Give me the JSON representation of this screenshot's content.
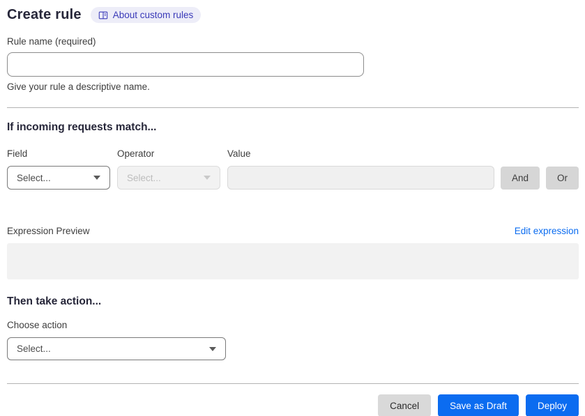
{
  "page": {
    "title": "Create rule",
    "about_link_label": "About custom rules"
  },
  "rule_name": {
    "label": "Rule name (required)",
    "value": "",
    "helper": "Give your rule a descriptive name."
  },
  "match_section": {
    "heading": "If incoming requests match...",
    "field": {
      "label": "Field",
      "selected": "Select..."
    },
    "operator": {
      "label": "Operator",
      "selected": "Select..."
    },
    "value": {
      "label": "Value",
      "value": ""
    },
    "and_button_label": "And",
    "or_button_label": "Or",
    "expression_preview_label": "Expression Preview",
    "edit_expression_link": "Edit expression",
    "expression_value": ""
  },
  "action_section": {
    "heading": "Then take action...",
    "choose_action_label": "Choose action",
    "action_selected": "Select..."
  },
  "footer": {
    "cancel_label": "Cancel",
    "save_draft_label": "Save as Draft",
    "deploy_label": "Deploy"
  },
  "colors": {
    "primary_blue": "#0b6cf0",
    "link_blue": "#0b6cf0",
    "badge_bg": "#ededf8",
    "badge_text": "#3a3ab8",
    "disabled_bg": "#f2f2f2",
    "neutral_button_bg": "#d6d6d6"
  }
}
